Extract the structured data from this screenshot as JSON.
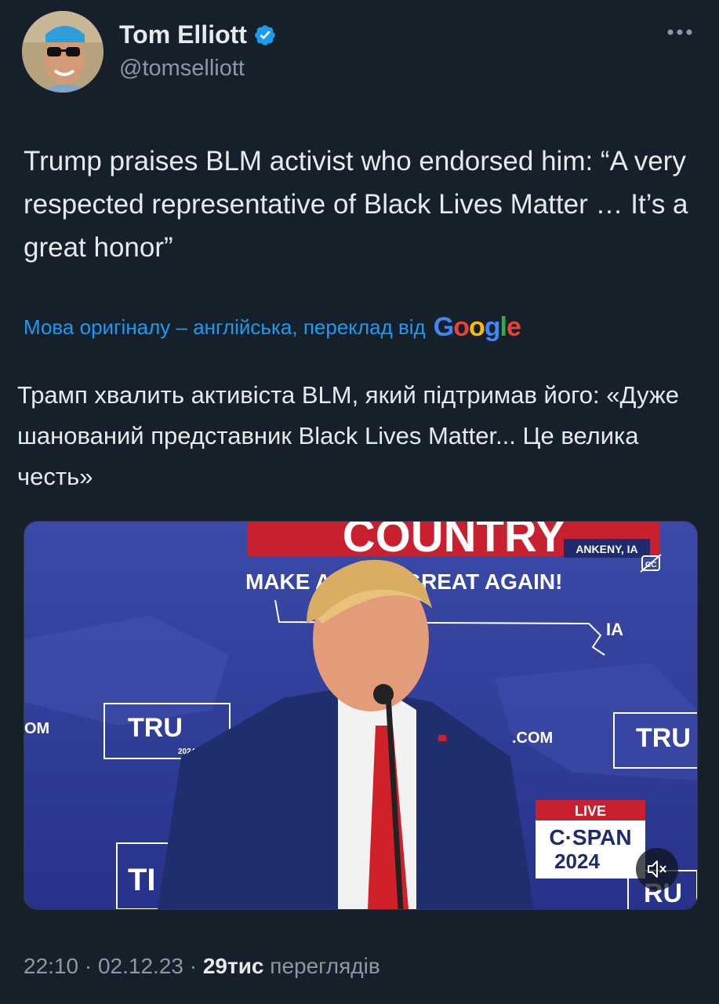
{
  "author": {
    "display_name": "Tom Elliott",
    "handle": "@tomselliott",
    "verified": true,
    "verified_color": "#1d9bf0"
  },
  "tweet": {
    "text": "Trump praises BLM activist who endorsed him: “A very respected  representative of Black Lives Matter … It’s a great honor”",
    "translation_notice": "Мова оригіналу – англійська, переклад від",
    "translation_provider": "Google",
    "translated_text": "Трамп хвалить активіста BLM, який підтримав його: «Дуже шанований представник Black Lives Matter... Це велика честь»"
  },
  "video": {
    "banner_top": "COUNTRY",
    "banner_slogan": "MAKE A      CA GREAT AGAIN!",
    "location_badge": "ANKENY, IA",
    "state_label": "IA",
    "sign_left": "TRU",
    "sign_right": "TRU",
    "sign_sub": "MAKE AMERICA GREAT AGAIN",
    "sign_year": "2024",
    "com_left": "OM",
    "com_mid": ".COM",
    "live_label": "LIVE",
    "network": "C·SPAN",
    "network_year": "2024",
    "icons": [
      "captions-off-icon",
      "mute-icon"
    ]
  },
  "meta": {
    "time": "22:10",
    "separator": "·",
    "date": "02.12.23",
    "views_count": "29тис",
    "views_label": "переглядів"
  }
}
